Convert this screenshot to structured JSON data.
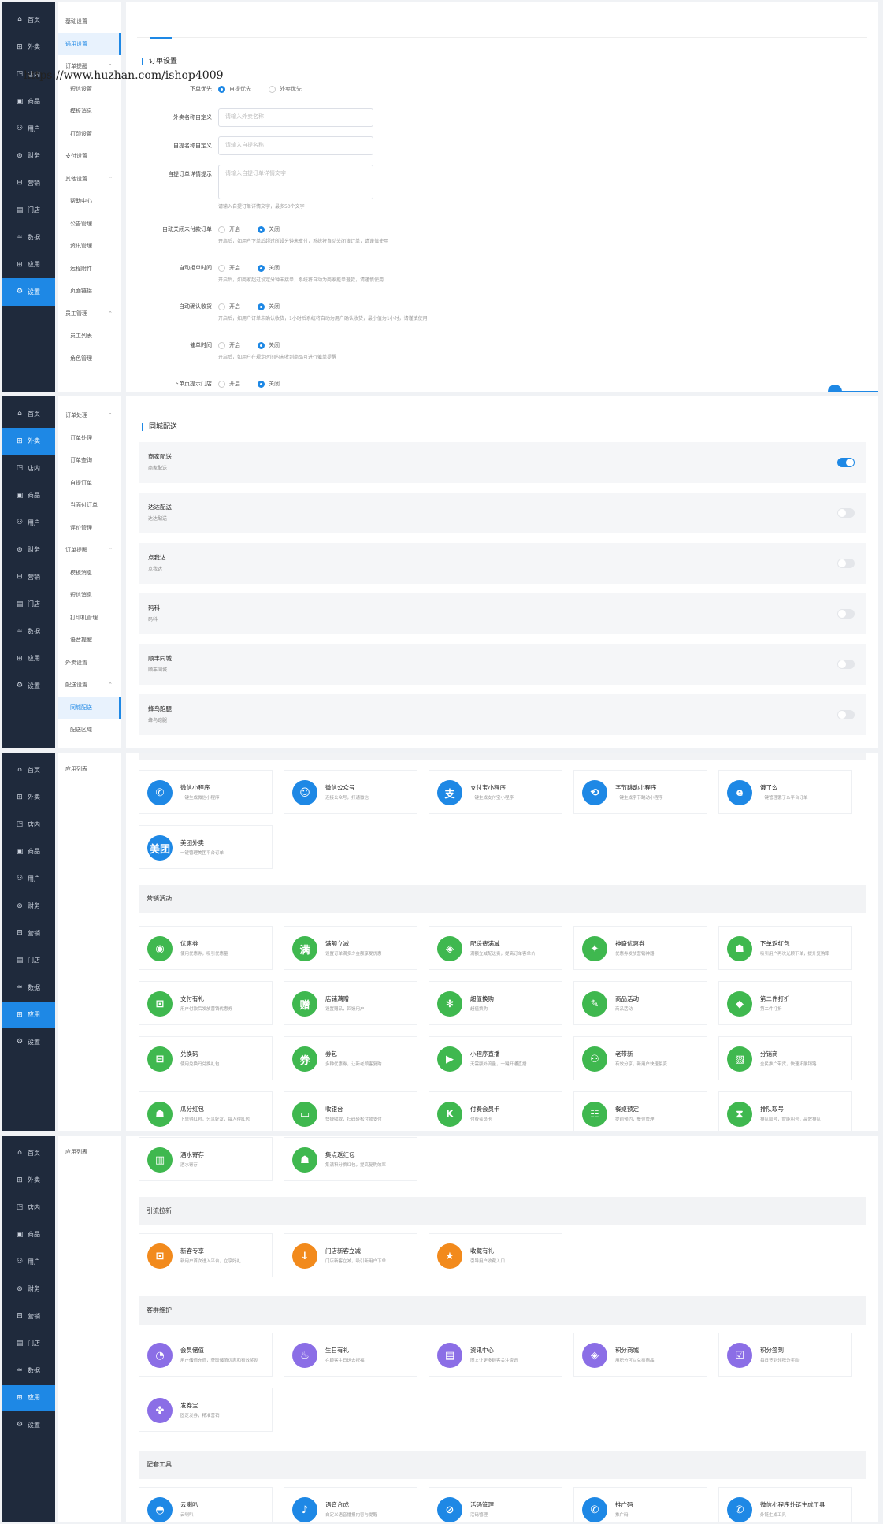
{
  "watermark": "https://www.huzhan.com/ishop4009",
  "sidebar": {
    "items": [
      {
        "label": "首页",
        "icon": "home-icon",
        "glyph": "⌂"
      },
      {
        "label": "外卖",
        "icon": "takeout-icon",
        "glyph": "⊞"
      },
      {
        "label": "店内",
        "icon": "dinein-icon",
        "glyph": "◳"
      },
      {
        "label": "商品",
        "icon": "goods-icon",
        "glyph": "▣"
      },
      {
        "label": "用户",
        "icon": "user-icon",
        "glyph": "⚇"
      },
      {
        "label": "财务",
        "icon": "finance-icon",
        "glyph": "⊛"
      },
      {
        "label": "营销",
        "icon": "gift-icon",
        "glyph": "⊟"
      },
      {
        "label": "门店",
        "icon": "store-icon",
        "glyph": "▤"
      },
      {
        "label": "数据",
        "icon": "data-icon",
        "glyph": "≃"
      },
      {
        "label": "应用",
        "icon": "apps-icon",
        "glyph": "⊞"
      },
      {
        "label": "设置",
        "icon": "settings-icon",
        "glyph": "⚙"
      }
    ]
  },
  "panel1": {
    "subnav": [
      {
        "label": "基础设置",
        "child": false,
        "chev": ""
      },
      {
        "label": "通用设置",
        "child": false,
        "chev": "",
        "active": true
      },
      {
        "label": "订单提醒",
        "child": false,
        "chev": "⌃"
      },
      {
        "label": "短信设置",
        "child": true,
        "chev": ""
      },
      {
        "label": "模板消息",
        "child": true,
        "chev": ""
      },
      {
        "label": "打印设置",
        "child": true,
        "chev": ""
      },
      {
        "label": "支付设置",
        "child": false,
        "chev": ""
      },
      {
        "label": "其他设置",
        "child": false,
        "chev": "⌃"
      },
      {
        "label": "帮助中心",
        "child": true,
        "chev": ""
      },
      {
        "label": "公告管理",
        "child": true,
        "chev": ""
      },
      {
        "label": "资讯管理",
        "child": true,
        "chev": ""
      },
      {
        "label": "远程附件",
        "child": true,
        "chev": ""
      },
      {
        "label": "页面链接",
        "child": true,
        "chev": ""
      },
      {
        "label": "员工管理",
        "child": false,
        "chev": "⌃"
      },
      {
        "label": "员工列表",
        "child": true,
        "chev": ""
      },
      {
        "label": "角色管理",
        "child": true,
        "chev": ""
      }
    ],
    "section_title": "订单设置",
    "order_priority": {
      "label": "下单优先",
      "opt1": "自提优先",
      "opt2": "外卖优先"
    },
    "takeout_name": {
      "label": "外卖名称自定义",
      "placeholder": "请输入外卖名称"
    },
    "pickup_name": {
      "label": "自提名称自定义",
      "placeholder": "请输入自提名称"
    },
    "pickup_tip": {
      "label": "自提订单详情提示",
      "placeholder": "请输入自提订单详情文字",
      "hint": "请输入自提订单详情文字，最多50个文字"
    },
    "auto_close": {
      "label": "自动关闭未付款订单",
      "on": "开启",
      "off": "关闭",
      "hint": "开启后，如用户下单后超过所设分钟未支付，系统将自动关闭该订单，请谨慎使用"
    },
    "auto_reject": {
      "label": "自动拒单时间",
      "on": "开启",
      "off": "关闭",
      "hint": "开启后，如商家超过设定分钟未接单，系统将自动为商家拒单退款，请谨慎使用"
    },
    "auto_confirm": {
      "label": "自动确认收货",
      "on": "开启",
      "off": "关闭",
      "hint": "开启后，如用户订单未确认收货，1小时后系统将自动为用户确认收货，最小值为1小时，请谨慎使用"
    },
    "urge": {
      "label": "催单时间",
      "on": "开启",
      "off": "关闭",
      "hint": "开启后，如用户在规定时间内未收到商品可进行催单提醒"
    },
    "store_tip": {
      "label": "下单页提示门店",
      "on": "开启",
      "off": "关闭"
    }
  },
  "panel2": {
    "subnav": [
      {
        "label": "订单处理",
        "child": false,
        "chev": "⌃"
      },
      {
        "label": "订单处理",
        "child": true,
        "chev": ""
      },
      {
        "label": "订单查询",
        "child": true,
        "chev": ""
      },
      {
        "label": "自提订单",
        "child": true,
        "chev": ""
      },
      {
        "label": "当面付订单",
        "child": true,
        "chev": ""
      },
      {
        "label": "评价管理",
        "child": true,
        "chev": ""
      },
      {
        "label": "订单提醒",
        "child": false,
        "chev": "⌃"
      },
      {
        "label": "模板消息",
        "child": true,
        "chev": ""
      },
      {
        "label": "短信消息",
        "child": true,
        "chev": ""
      },
      {
        "label": "打印机管理",
        "child": true,
        "chev": ""
      },
      {
        "label": "语音提醒",
        "child": true,
        "chev": ""
      },
      {
        "label": "外卖设置",
        "child": false,
        "chev": ""
      },
      {
        "label": "配送设置",
        "child": false,
        "chev": "⌃"
      },
      {
        "label": "同城配送",
        "child": true,
        "chev": "",
        "active": true
      },
      {
        "label": "配送区域",
        "child": true,
        "chev": ""
      }
    ],
    "section_title": "同城配送",
    "rows": [
      {
        "name": "商家配送",
        "desc": "商家配送",
        "on": true
      },
      {
        "name": "达达配送",
        "desc": "达达配送",
        "on": false
      },
      {
        "name": "点我达",
        "desc": "点我达",
        "on": false
      },
      {
        "name": "码科",
        "desc": "码科",
        "on": false
      },
      {
        "name": "顺丰同城",
        "desc": "顺丰同城",
        "on": false
      },
      {
        "name": "蜂鸟跑腿",
        "desc": "蜂鸟跑腿",
        "on": false
      }
    ]
  },
  "panel3": {
    "app_list_label": "应用列表",
    "group_marketing": "营销活动",
    "channel_apps": [
      {
        "title": "微信小程序",
        "desc": "一键生成微信小程序",
        "color": "#1e88e5",
        "glyph": "✆",
        "icon": "wechat-miniapp-icon"
      },
      {
        "title": "微信公众号",
        "desc": "连接公众号，打通微信",
        "color": "#1e88e5",
        "glyph": "☺",
        "icon": "wechat-official-icon"
      },
      {
        "title": "支付宝小程序",
        "desc": "一键生成支付宝小程序",
        "color": "#1e88e5",
        "glyph": "支",
        "icon": "alipay-icon"
      },
      {
        "title": "字节跳动小程序",
        "desc": "一键生成字节跳动小程序",
        "color": "#1e88e5",
        "glyph": "⟲",
        "icon": "bytedance-icon"
      },
      {
        "title": "饿了么",
        "desc": "一键管理饿了么平台订单",
        "color": "#1e88e5",
        "glyph": "e",
        "icon": "eleme-icon"
      },
      {
        "title": "美团外卖",
        "desc": "一键管理美团平台订单",
        "color": "#1e88e5",
        "glyph": "美团",
        "icon": "meituan-icon"
      }
    ],
    "marketing_apps": [
      {
        "title": "优惠券",
        "desc": "使用优惠券，吸引优惠量",
        "color": "#3fb84f",
        "glyph": "◉",
        "icon": "coupon-icon"
      },
      {
        "title": "满额立减",
        "desc": "设置订单满多少金额享受优惠",
        "color": "#3fb84f",
        "glyph": "满",
        "icon": "full-reduce-icon"
      },
      {
        "title": "配送费满减",
        "desc": "满额立减配送费，提高订单客单价",
        "color": "#3fb84f",
        "glyph": "◈",
        "icon": "delivery-fee-icon"
      },
      {
        "title": "神奇优惠券",
        "desc": "优惠券发放营销神器",
        "color": "#3fb84f",
        "glyph": "✦",
        "icon": "magic-coupon-icon"
      },
      {
        "title": "下单返红包",
        "desc": "吸引用户再次光顾下单，提升复购率",
        "color": "#3fb84f",
        "glyph": "☗",
        "icon": "order-redpacket-icon"
      },
      {
        "title": "支付有礼",
        "desc": "用户付款后发放营销优惠券",
        "color": "#3fb84f",
        "glyph": "⊡",
        "icon": "pay-gift-icon"
      },
      {
        "title": "店铺满赠",
        "desc": "设置赠品，回馈用户",
        "color": "#3fb84f",
        "glyph": "赠",
        "icon": "store-gift-icon"
      },
      {
        "title": "超值换购",
        "desc": "超值换购",
        "color": "#3fb84f",
        "glyph": "✻",
        "icon": "exchange-icon"
      },
      {
        "title": "商品活动",
        "desc": "商品活动",
        "color": "#3fb84f",
        "glyph": "✎",
        "icon": "goods-activity-icon"
      },
      {
        "title": "第二件打折",
        "desc": "第二件打折",
        "color": "#3fb84f",
        "glyph": "◆",
        "icon": "second-discount-icon"
      },
      {
        "title": "兑换码",
        "desc": "使用兑换码兑换礼包",
        "color": "#3fb84f",
        "glyph": "⊟",
        "icon": "redeem-code-icon"
      },
      {
        "title": "券包",
        "desc": "多种优惠券，让新老顾客复购",
        "color": "#3fb84f",
        "glyph": "券",
        "icon": "coupon-pack-icon"
      },
      {
        "title": "小程序直播",
        "desc": "无需额外流量，一键开通直播",
        "color": "#3fb84f",
        "glyph": "▶",
        "icon": "live-icon"
      },
      {
        "title": "老带新",
        "desc": "有效分享，新用户快速裂变",
        "color": "#3fb84f",
        "glyph": "⚇",
        "icon": "invite-icon"
      },
      {
        "title": "分销商",
        "desc": "全民推广带货，快速拓展销路",
        "color": "#3fb84f",
        "glyph": "▨",
        "icon": "distributor-icon"
      },
      {
        "title": "瓜分红包",
        "desc": "下单得红包，分享好友，每人得红包",
        "color": "#3fb84f",
        "glyph": "☗",
        "icon": "split-redpacket-icon"
      },
      {
        "title": "收银台",
        "desc": "快捷收款，扫码轻松付款支付",
        "color": "#3fb84f",
        "glyph": "▭",
        "icon": "cashier-icon"
      },
      {
        "title": "付费会员卡",
        "desc": "付费会员卡",
        "color": "#3fb84f",
        "glyph": "K",
        "icon": "member-card-icon"
      },
      {
        "title": "餐桌预定",
        "desc": "提前预约，餐位管理",
        "color": "#3fb84f",
        "glyph": "☷",
        "icon": "table-booking-icon"
      },
      {
        "title": "排队取号",
        "desc": "排队取号，智能叫号，高效排队",
        "color": "#3fb84f",
        "glyph": "⧗",
        "icon": "queue-icon"
      }
    ]
  },
  "panel4": {
    "app_list_label": "应用列表",
    "top_apps": [
      {
        "title": "酒水寄存",
        "desc": "酒水寄存",
        "color": "#3fb84f",
        "glyph": "▥",
        "icon": "wine-storage-icon"
      },
      {
        "title": "集点返红包",
        "desc": "集满积分换红包，提高复购效率",
        "color": "#3fb84f",
        "glyph": "☗",
        "icon": "points-redpacket-icon"
      }
    ],
    "group_traffic": "引流拉新",
    "traffic_apps": [
      {
        "title": "新客专享",
        "desc": "新用户首次进入平台，立享好礼",
        "color": "#f28a1c",
        "glyph": "⊡",
        "icon": "new-customer-icon"
      },
      {
        "title": "门店新客立减",
        "desc": "门店新客立减，吸引新用户下单",
        "color": "#f28a1c",
        "glyph": "↓",
        "icon": "store-new-icon"
      },
      {
        "title": "收藏有礼",
        "desc": "引导用户收藏入口",
        "color": "#f28a1c",
        "glyph": "★",
        "icon": "favorite-gift-icon"
      }
    ],
    "group_retention": "客群维护",
    "retention_apps": [
      {
        "title": "会员储值",
        "desc": "用户储值充值，获取储值优惠和有效奖励",
        "color": "#8b6ee6",
        "glyph": "◔",
        "icon": "member-deposit-icon"
      },
      {
        "title": "生日有礼",
        "desc": "在顾客生日送去祝福",
        "color": "#8b6ee6",
        "glyph": "♨",
        "icon": "birthday-icon"
      },
      {
        "title": "资讯中心",
        "desc": "图文让更多顾客关注资讯",
        "color": "#8b6ee6",
        "glyph": "▤",
        "icon": "news-center-icon"
      },
      {
        "title": "积分商城",
        "desc": "用积分可以兑换商品",
        "color": "#8b6ee6",
        "glyph": "◈",
        "icon": "points-mall-icon"
      },
      {
        "title": "积分签到",
        "desc": "每日签到领积分奖励",
        "color": "#8b6ee6",
        "glyph": "☑",
        "icon": "signin-icon"
      },
      {
        "title": "发券宝",
        "desc": "固定发券，精准营销",
        "color": "#8b6ee6",
        "glyph": "✤",
        "icon": "coupon-send-icon"
      }
    ],
    "group_tools": "配套工具",
    "tool_apps": [
      {
        "title": "云喇叭",
        "desc": "云喇叭",
        "color": "#1e88e5",
        "glyph": "◓",
        "icon": "cloud-speaker-icon"
      },
      {
        "title": "语音合成",
        "desc": "自定义语音播报内容与提醒",
        "color": "#1e88e5",
        "glyph": "♪",
        "icon": "voice-icon"
      },
      {
        "title": "活码管理",
        "desc": "活码管理",
        "color": "#1e88e5",
        "glyph": "⊘",
        "icon": "qrcode-icon"
      },
      {
        "title": "推广码",
        "desc": "推广码",
        "color": "#1e88e5",
        "glyph": "✆",
        "icon": "promo-code-icon"
      },
      {
        "title": "微信小程序外链生成工具",
        "desc": "外链生成工具",
        "color": "#1e88e5",
        "glyph": "✆",
        "icon": "link-tool-icon"
      }
    ]
  }
}
